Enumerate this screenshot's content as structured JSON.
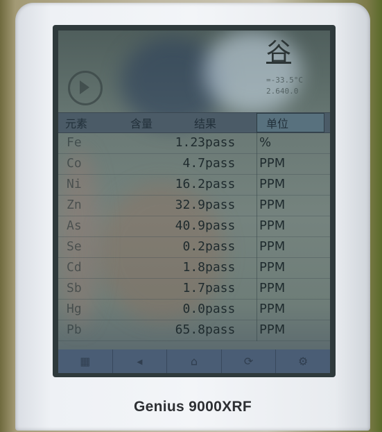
{
  "device": {
    "brand_label": "Genius 9000XRF"
  },
  "screen": {
    "top_title": "谷",
    "status_lines": [
      "=-33.5°C",
      "2.640.0"
    ],
    "table": {
      "headers": {
        "element": "元素",
        "content": "含量",
        "result": "结果",
        "unit": "单位"
      },
      "rows": [
        {
          "element": "Fe",
          "value": "1.23",
          "result": "pass",
          "unit": "%"
        },
        {
          "element": "Co",
          "value": "4.7",
          "result": "pass",
          "unit": "PPM"
        },
        {
          "element": "Ni",
          "value": "16.2",
          "result": "pass",
          "unit": "PPM"
        },
        {
          "element": "Zn",
          "value": "32.9",
          "result": "pass",
          "unit": "PPM"
        },
        {
          "element": "As",
          "value": "40.9",
          "result": "pass",
          "unit": "PPM"
        },
        {
          "element": "Se",
          "value": "0.2",
          "result": "pass",
          "unit": "PPM"
        },
        {
          "element": "Cd",
          "value": "1.8",
          "result": "pass",
          "unit": "PPM"
        },
        {
          "element": "Sb",
          "value": "1.7",
          "result": "pass",
          "unit": "PPM"
        },
        {
          "element": "Hg",
          "value": "0.0",
          "result": "pass",
          "unit": "PPM"
        },
        {
          "element": "Pb",
          "value": "65.8",
          "result": "pass",
          "unit": "PPM"
        }
      ]
    },
    "footer_icons": [
      "grid-icon",
      "arrow-icon",
      "home-icon",
      "refresh-icon",
      "settings-icon"
    ]
  },
  "colors": {
    "screen_bg": "#6b7a76",
    "header_bg": "#4b5b67",
    "footer_bg": "#4a5d75",
    "device_body": "#eef1f5"
  }
}
